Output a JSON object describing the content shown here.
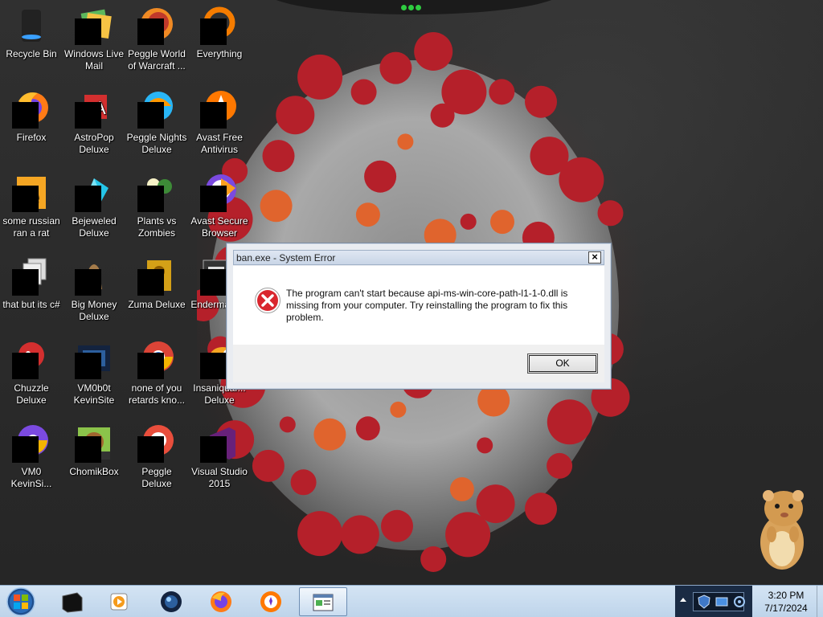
{
  "desktop": {
    "icons": [
      {
        "label": "Recycle Bin",
        "icon": "recycle-bin-icon"
      },
      {
        "label": "Windows Live Mail",
        "icon": "windows-live-mail-icon"
      },
      {
        "label": "Peggle World of Warcraft ...",
        "icon": "peggle-wow-icon"
      },
      {
        "label": "Everything",
        "icon": "everything-search-icon"
      },
      {
        "label": "Firefox",
        "icon": "firefox-icon"
      },
      {
        "label": "AstroPop Deluxe",
        "icon": "astropop-icon"
      },
      {
        "label": "Peggle Nights Deluxe",
        "icon": "peggle-nights-icon"
      },
      {
        "label": "Avast Free Antivirus",
        "icon": "avast-icon"
      },
      {
        "label": "some russian ran a rat",
        "icon": "java-file-icon"
      },
      {
        "label": "Bejeweled Deluxe",
        "icon": "bejeweled-icon"
      },
      {
        "label": "Plants vs Zombies",
        "icon": "plants-vs-zombies-icon"
      },
      {
        "label": "Avast Secure Browser",
        "icon": "avast-browser-icon"
      },
      {
        "label": "that but its c#",
        "icon": "file-stack-icon"
      },
      {
        "label": "Big Money Deluxe",
        "icon": "big-money-icon"
      },
      {
        "label": "Zuma Deluxe",
        "icon": "zuma-icon"
      },
      {
        "label": "Endermanc...",
        "icon": "terminal-icon"
      },
      {
        "label": "Chuzzle Deluxe",
        "icon": "chuzzle-icon"
      },
      {
        "label": "VM0b0t KevinSite",
        "icon": "vm0b0t-icon"
      },
      {
        "label": "none of you retards kno...",
        "icon": "chrome-icon"
      },
      {
        "label": "Insaniquar... Deluxe",
        "icon": "insaniquarium-icon"
      },
      {
        "label": "VM0 KevinSi...",
        "icon": "vm0-chrome-icon"
      },
      {
        "label": "ChomikBox",
        "icon": "chomikbox-icon"
      },
      {
        "label": "Peggle Deluxe",
        "icon": "peggle-icon"
      },
      {
        "label": "Visual Studio 2015",
        "icon": "visual-studio-icon"
      }
    ]
  },
  "dialog": {
    "title": "ban.exe - System Error",
    "close_label": "×",
    "message": "The program can't start because api-ms-win-core-path-l1-1-0.dll is missing from your computer. Try reinstalling the program to fix this problem.",
    "ok_label": "OK"
  },
  "taskbar": {
    "items": [
      {
        "icon": "start-orb-icon"
      },
      {
        "icon": "black-box-app-icon"
      },
      {
        "icon": "media-player-icon"
      },
      {
        "icon": "orb-app-icon"
      },
      {
        "icon": "firefox-icon"
      },
      {
        "icon": "avast-browser-icon"
      },
      {
        "icon": "system-error-window-icon",
        "active": true
      }
    ],
    "clock_time": "3:20 PM",
    "clock_date": "7/17/2024"
  },
  "colors": {
    "error_red": "#d9262e",
    "taskbar_bg": "#c8dcf0",
    "virus_spike_red": "#b5202a"
  }
}
